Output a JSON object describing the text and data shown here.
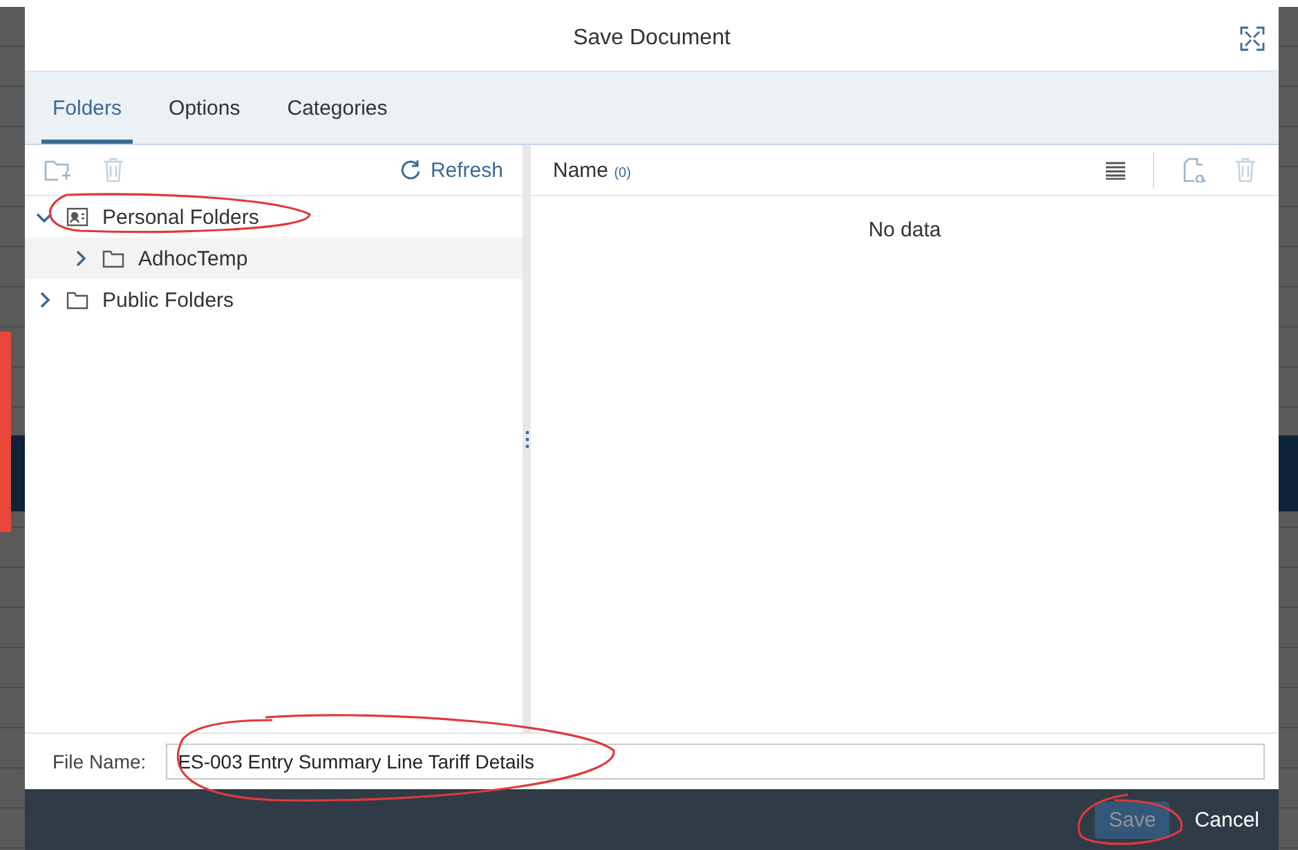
{
  "dialog": {
    "title": "Save Document"
  },
  "tabs": [
    {
      "label": "Folders",
      "selected": true
    },
    {
      "label": "Options",
      "selected": false
    },
    {
      "label": "Categories",
      "selected": false
    }
  ],
  "folder_toolbar": {
    "refresh_label": "Refresh"
  },
  "tree": [
    {
      "label": "Personal Folders",
      "kind": "personal",
      "expanded": true,
      "selected": false,
      "children": [
        {
          "label": "AdhocTemp",
          "kind": "folder",
          "expanded": false,
          "selected": true
        }
      ]
    },
    {
      "label": "Public Folders",
      "kind": "folder",
      "expanded": false,
      "selected": false
    }
  ],
  "list": {
    "column": "Name",
    "count": "(0)",
    "empty_text": "No data"
  },
  "file_name": {
    "label": "File Name:",
    "value": "ES-003 Entry Summary Line Tariff Details"
  },
  "buttons": [
    {
      "label": "Save",
      "kind": "emphasized",
      "disabled": true
    },
    {
      "label": "Cancel",
      "kind": "transparent",
      "disabled": false
    }
  ]
}
